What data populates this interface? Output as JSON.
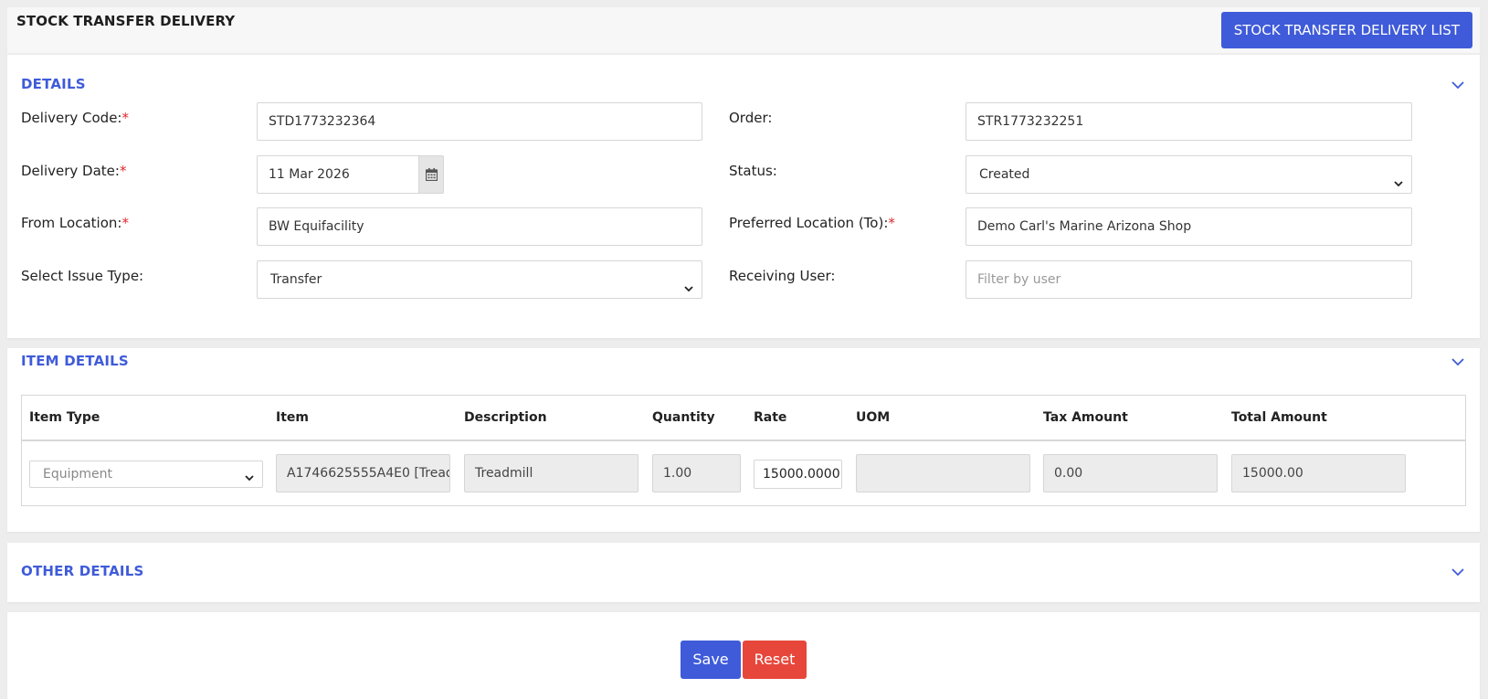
{
  "header": {
    "title": "STOCK TRANSFER DELIVERY",
    "list_button": "STOCK TRANSFER DELIVERY LIST"
  },
  "details": {
    "section_title": "DETAILS",
    "fields": {
      "delivery_code": {
        "label": "Delivery Code:",
        "required": "*",
        "value": "STD1773232364"
      },
      "order": {
        "label": "Order:",
        "value": "STR1773232251"
      },
      "delivery_date": {
        "label": "Delivery Date:",
        "required": "*",
        "value": "11 Mar 2026"
      },
      "status": {
        "label": "Status:",
        "value": "Created"
      },
      "from_location": {
        "label": "From Location:",
        "required": "*",
        "value": "BW Equifacility"
      },
      "preferred_location": {
        "label": "Preferred Location (To):",
        "required": "*",
        "value": "Demo Carl's Marine Arizona Shop"
      },
      "issue_type": {
        "label": "Select Issue Type:",
        "value": "Transfer"
      },
      "receiving_user": {
        "label": "Receiving User:",
        "placeholder": "Filter by user",
        "value": ""
      }
    }
  },
  "item_details": {
    "section_title": "ITEM DETAILS",
    "columns": [
      "Item Type",
      "Item",
      "Description",
      "Quantity",
      "Rate",
      "UOM",
      "Tax Amount",
      "Total Amount"
    ],
    "rows": [
      {
        "item_type": "Equipment",
        "item": "A1746625555A4E0 [Tread",
        "description": "Treadmill",
        "quantity": "1.00",
        "rate": "15000.0000",
        "uom": "",
        "tax_amount": "0.00",
        "total_amount": "15000.00"
      }
    ]
  },
  "other_details": {
    "section_title": "OTHER DETAILS"
  },
  "actions": {
    "save": "Save",
    "reset": "Reset"
  },
  "colors": {
    "accent": "#3f5bd9",
    "danger": "#e6473a",
    "required": "#e0262c"
  },
  "icons": [
    "calendar-icon",
    "chevron-down-icon",
    "select-arrow-icon"
  ]
}
